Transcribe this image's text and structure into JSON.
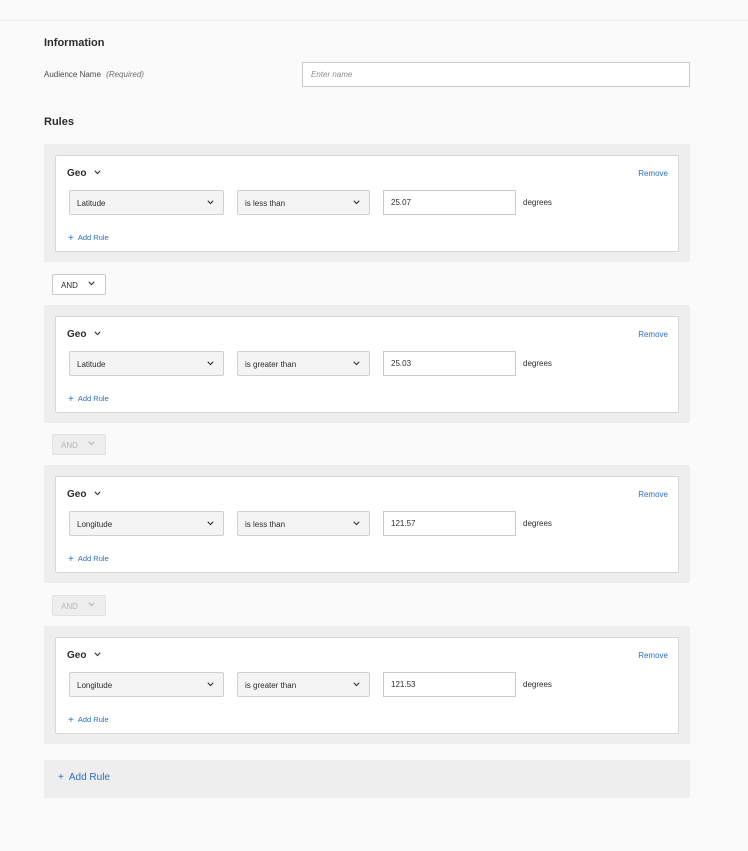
{
  "information": {
    "title": "Information",
    "audience_name_label": "Audience Name",
    "required_text": "(Required)",
    "audience_name_placeholder": "Enter name",
    "audience_name_value": ""
  },
  "rules": {
    "title": "Rules",
    "groups": [
      {
        "title": "Geo",
        "remove_label": "Remove",
        "field": "Latitude",
        "operator": "is less than",
        "value": "25.07",
        "unit": "degrees",
        "add_rule_label": "Add Rule"
      },
      {
        "title": "Geo",
        "remove_label": "Remove",
        "field": "Latitude",
        "operator": "is greater than",
        "value": "25.03",
        "unit": "degrees",
        "add_rule_label": "Add Rule"
      },
      {
        "title": "Geo",
        "remove_label": "Remove",
        "field": "Longitude",
        "operator": "is less than",
        "value": "121.57",
        "unit": "degrees",
        "add_rule_label": "Add Rule"
      },
      {
        "title": "Geo",
        "remove_label": "Remove",
        "field": "Longitude",
        "operator": "is greater than",
        "value": "121.53",
        "unit": "degrees",
        "add_rule_label": "Add Rule"
      }
    ],
    "connectors": [
      {
        "label": "AND",
        "disabled": false
      },
      {
        "label": "AND",
        "disabled": true
      },
      {
        "label": "AND",
        "disabled": true
      }
    ],
    "add_rule_label": "Add Rule"
  },
  "icons": {
    "chevron": "chevron-down-icon",
    "plus": "plus-icon"
  },
  "colors": {
    "link": "#2d6ec0",
    "group_background": "#eeeeee",
    "page_background": "#fafafa"
  }
}
